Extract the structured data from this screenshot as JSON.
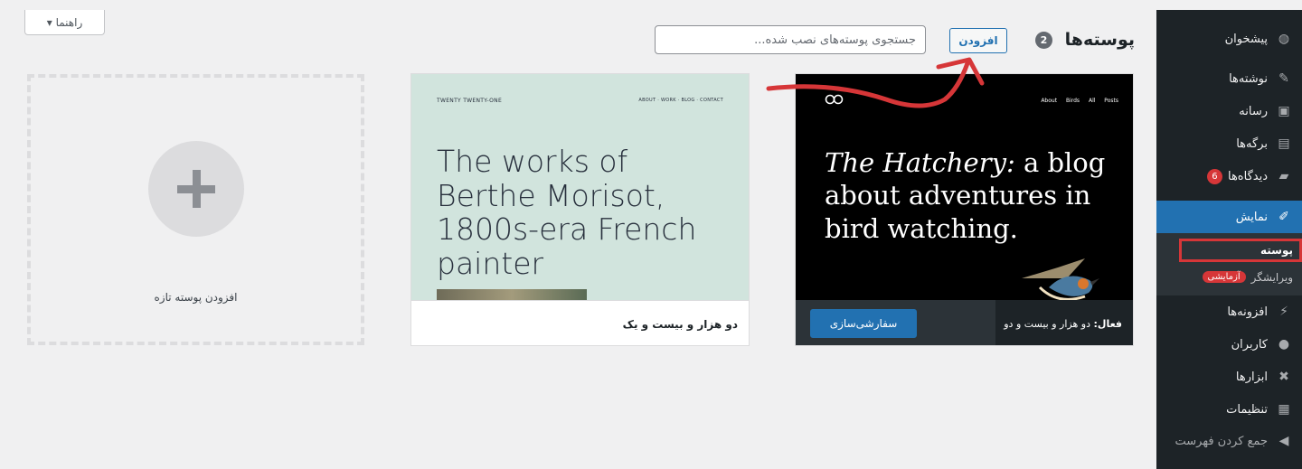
{
  "help_tab": {
    "label": "راهنما ▾"
  },
  "header": {
    "title": "پوسته‌ها",
    "count": "2",
    "add_button": "افزودن",
    "search_placeholder": "جستجوی پوسته‌های نصب شده..."
  },
  "add_new": {
    "label": "افزودن پوسته تازه"
  },
  "themes": [
    {
      "name": "دو هزار و بیست و یک",
      "preview": {
        "site_title": "TWENTY TWENTY-ONE",
        "nav": "ABOUT · WORK · BLOG · CONTACT",
        "headline": "The works of Berthe Morisot, 1800s-era French painter"
      }
    },
    {
      "active_prefix": "فعال:",
      "name": "دو هزار و بیست و دو",
      "customize_label": "سفارشی‌سازی",
      "preview": {
        "nav": "About Birds All Posts",
        "headline_italic": "The Hatchery:",
        "headline_rest": " a blog about adventures in bird watching."
      }
    }
  ],
  "sidebar": {
    "items": [
      {
        "label": "پیشخوان",
        "icon": "dashboard-icon"
      },
      {
        "label": "نوشته‌ها",
        "icon": "pin-icon"
      },
      {
        "label": "رسانه",
        "icon": "media-icon"
      },
      {
        "label": "برگه‌ها",
        "icon": "page-icon"
      },
      {
        "label": "دیدگاه‌ها",
        "icon": "comment-icon",
        "badge": "6"
      },
      {
        "label": "نمایش",
        "icon": "brush-icon"
      }
    ],
    "submenu": [
      {
        "label": "پوسته"
      },
      {
        "label": "ویرایشگر",
        "badge": "آزمایشی"
      }
    ],
    "items_after": [
      {
        "label": "افزونه‌ها",
        "icon": "plugin-icon"
      },
      {
        "label": "کاربران",
        "icon": "user-icon"
      },
      {
        "label": "ابزارها",
        "icon": "wrench-icon"
      },
      {
        "label": "تنظیمات",
        "icon": "settings-icon"
      },
      {
        "label": "جمع کردن فهرست",
        "icon": "collapse-icon"
      }
    ]
  },
  "colors": {
    "accent": "#2271b1",
    "sidebar": "#1d2327",
    "highlight": "#d63638"
  }
}
